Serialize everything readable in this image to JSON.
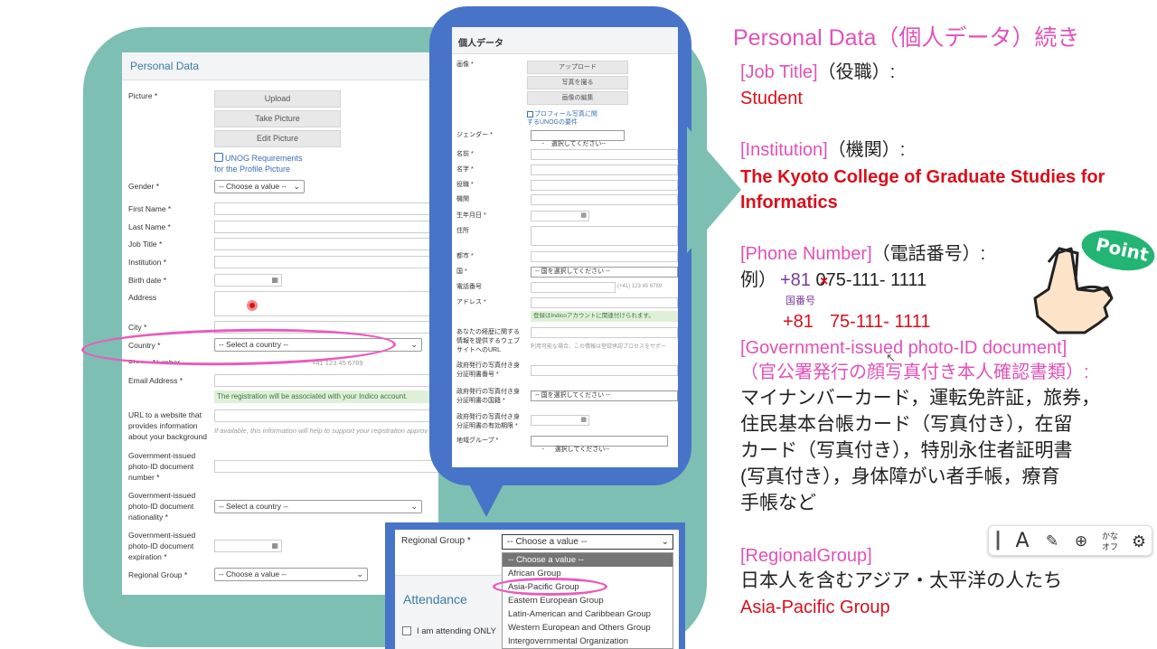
{
  "left_form": {
    "title": "Personal Data",
    "picture_label": "Picture *",
    "upload_label": "Upload",
    "take_picture_label": "Take Picture",
    "edit_picture_label": "Edit Picture",
    "requirements_link_1": "UNOG Requirements",
    "requirements_link_2": "for the Profile Picture",
    "gender_label": "Gender *",
    "gender_value": "-- Choose a value --",
    "first_name_label": "First Name *",
    "last_name_label": "Last Name *",
    "job_title_label": "Job Title *",
    "institution_label": "Institution *",
    "birth_date_label": "Birth date *",
    "address_label": "Address",
    "city_label": "City *",
    "country_label": "Country *",
    "country_value": "-- Select a country --",
    "phone_label": "Phone Number",
    "phone_hint": "+41 123 45 6789",
    "email_label": "Email Address *",
    "email_note": "The registration will be associated with your Indico account.",
    "url_label_1": "URL to a website that",
    "url_label_2": "provides information",
    "url_label_3": "about your background",
    "url_hint": "If available, this information will help to support your registration approv",
    "gov_number_label_1": "Government-issued",
    "gov_number_label_2": "photo-ID document",
    "gov_number_label_3": "number *",
    "gov_nat_label_1": "Government-issued",
    "gov_nat_label_2": "photo-ID document",
    "gov_nat_label_3": "nationality *",
    "gov_nat_value": "-- Select a country --",
    "gov_exp_label_1": "Government-issued",
    "gov_exp_label_2": "photo-ID document",
    "gov_exp_label_3": "expiration *",
    "regional_label": "Regional Group *",
    "regional_value": "-- Choose a value --"
  },
  "jp_form": {
    "title": "個人データ",
    "picture_label": "画像 *",
    "upload_label": "アップロード",
    "take_label": "写真を撮る",
    "edit_label": "画像の編集",
    "link_1": "プロフィール写真に関",
    "link_2": "するUNOGの要件",
    "gender_label": "ジェンダー *",
    "gender_value": "-    選択してください--",
    "first_name_label": "名前 *",
    "last_name_label": "名字 *",
    "job_label": "役職 *",
    "institution_label": "機関",
    "birth_label": "生年月日 *",
    "address_label": "住所",
    "city_label": "都市 *",
    "country_label": "国 *",
    "country_value": "-- 国を選択してください --",
    "phone_label": "電話番号",
    "phone_hint": "(+41) 123 45 6789",
    "email_label": "アドレス *",
    "email_note": "登録はIndicoアカウントに関連付けられます。",
    "url_label_1": "あなたの経歴に関する",
    "url_label_2": "情報を提供するウェブ",
    "url_label_3": "サイトへのURL",
    "url_hint": "利用可能な場合、この情報は登録承認プロセスをサポー",
    "gov_number_label_1": "政府発行の写真付き身",
    "gov_number_label_2": "分証明書番号 *",
    "gov_nat_label_1": "政府発行の写真付き身",
    "gov_nat_label_2": "分証明書の国籍 *",
    "gov_nat_value": "-- 国を選択してください --",
    "gov_exp_label_1": "政府発行の写真付き身",
    "gov_exp_label_2": "分証明書の有効期限 *",
    "regional_label": "地域グループ *",
    "regional_value": "-      選択してください--"
  },
  "dropdown": {
    "label": "Regional Group *",
    "selected": "-- Choose a value --",
    "attendance": "Attendance",
    "attending": "I am attending ONLY",
    "options": [
      "-- Choose a value --",
      "African Group",
      "Asia-Pacific Group",
      "Eastern European Group",
      "Latin-American and Caribbean Group",
      "Western European and Others Group",
      "Intergovernmental Organization"
    ]
  },
  "caption": {
    "title": "Personal Data（個人データ）続き",
    "job_heading": "[Job Title]",
    "job_jp": "（役職）:",
    "job_value": "Student",
    "inst_heading": "[Institution]",
    "inst_jp": "（機関）:",
    "inst_value_1": "The Kyoto College of Graduate Studies for",
    "inst_value_2": "Informatics",
    "phone_heading": "[Phone Number]",
    "phone_jp": "（電話番号）:",
    "example_prefix": "例）",
    "example_code": "+81",
    "example_zero": "0",
    "example_number": "75-111- 1111",
    "country_code_note": "国番号",
    "phone_result_code": "+81",
    "phone_result_number": "75-111- 1111",
    "gov_heading": "[Government-issued photo-ID document]",
    "gov_jp": "（官公署発行の顔写真付き本人確認書類）:",
    "gov_line_1": "マイナンバーカード，運転免許証，旅券，",
    "gov_line_2": "住民基本台帳カード（写真付き），在留",
    "gov_line_3": "カード（写真付き），特別永住者証明書",
    "gov_line_4": "(写真付き），身体障がい者手帳，療育",
    "gov_line_5": "手帳など",
    "regional_heading": "[RegionalGroup]",
    "regional_desc": "日本人を含むアジア・太平洋の人たち",
    "regional_value": "Asia-Pacific Group",
    "point_label": "Point"
  },
  "toolbar": {
    "kana_label": "かな\nオフ",
    "icons": [
      "text-cursor-icon",
      "font-size-icon",
      "handwriting-icon",
      "add-note-icon",
      "kana-off-icon",
      "settings-icon"
    ]
  },
  "colors": {
    "accent_pink": "#e052b8",
    "accent_red": "#d8101c",
    "teal": "#7dbfb3",
    "bubble_blue": "#4774c8"
  }
}
